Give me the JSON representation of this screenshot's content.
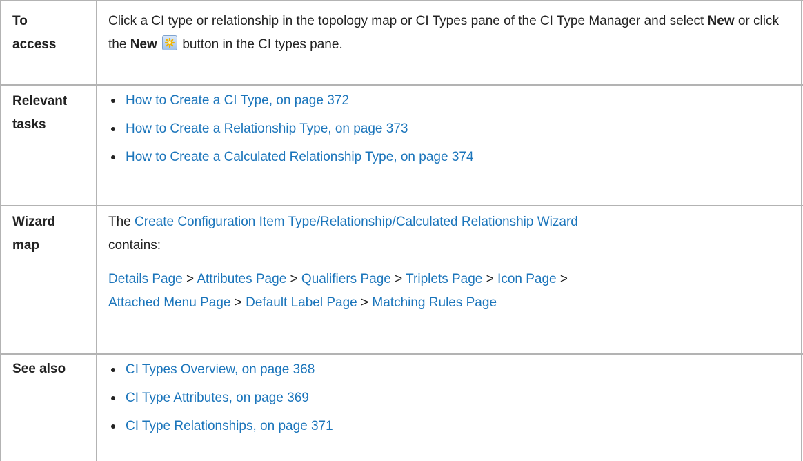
{
  "rows": [
    {
      "header": "To access",
      "header_lines": [
        "To",
        "access"
      ],
      "text_part1": "Click a CI type or relationship in the topology map or CI Types pane of the CI Type Manager and select ",
      "bold1": "New",
      "text_part2": " or click the ",
      "bold2": "New",
      "text_part3": " button in the CI types pane.",
      "icon": "new-star-icon"
    },
    {
      "header_lines": [
        "Relevant",
        "tasks"
      ],
      "items": [
        "How to Create a CI Type, on page 372",
        "How to Create a Relationship Type, on page 373",
        "How to Create a Calculated Relationship Type, on page 374"
      ]
    },
    {
      "header_lines": [
        "Wizard",
        "map"
      ],
      "intro_prefix": "The ",
      "intro_link": "Create Configuration Item Type/Relationship/Calculated Relationship Wizard",
      "intro_suffix": "contains:",
      "pages": [
        "Details Page",
        "Attributes Page",
        "Qualifiers Page",
        "Triplets Page",
        "Icon Page",
        "Attached Menu Page",
        "Default Label Page",
        "Matching Rules Page"
      ],
      "separator": " > "
    },
    {
      "header": "See also",
      "items": [
        "CI Types Overview, on page 368",
        "CI Type Attributes, on page 369",
        "CI Type Relationships, on page 371"
      ]
    }
  ],
  "colors": {
    "link": "#1b75bb",
    "border": "#b3b3b3",
    "text": "#222222"
  }
}
